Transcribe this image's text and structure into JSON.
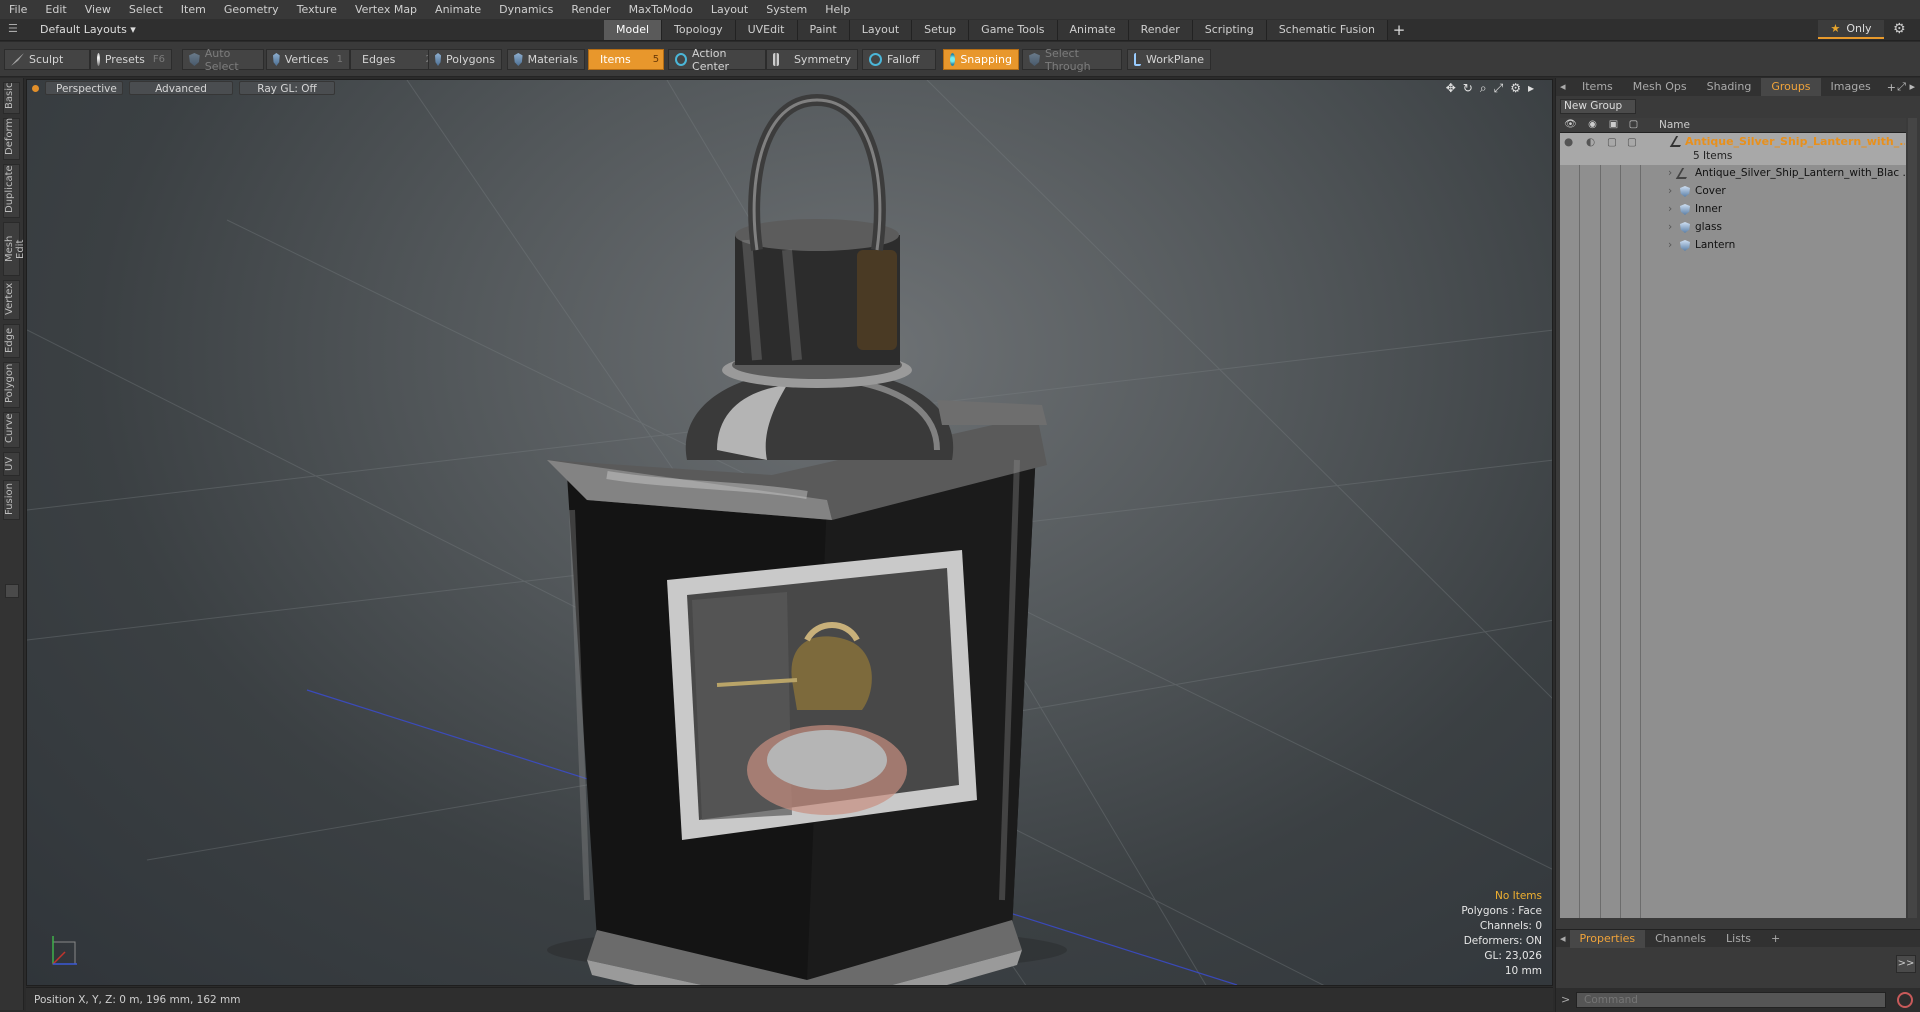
{
  "menu": [
    "File",
    "Edit",
    "View",
    "Select",
    "Item",
    "Geometry",
    "Texture",
    "Vertex Map",
    "Animate",
    "Dynamics",
    "Render",
    "MaxToModo",
    "Layout",
    "System",
    "Help"
  ],
  "layout": {
    "selector": "Default Layouts ▾",
    "only_label": "Only"
  },
  "mode_tabs": [
    {
      "label": "Model",
      "active": true
    },
    {
      "label": "Topology"
    },
    {
      "label": "UVEdit"
    },
    {
      "label": "Paint"
    },
    {
      "label": "Layout"
    },
    {
      "label": "Setup"
    },
    {
      "label": "Game Tools"
    },
    {
      "label": "Animate"
    },
    {
      "label": "Render"
    },
    {
      "label": "Scripting"
    },
    {
      "label": "Schematic Fusion"
    }
  ],
  "toolbar": {
    "sculpt": "Sculpt",
    "presets": "Presets",
    "presets_key": "F6",
    "auto_select": "Auto Select",
    "vertices": "Vertices",
    "vertices_key": "1",
    "edges": "Edges",
    "edges_key": "2",
    "polygons": "Polygons",
    "materials": "Materials",
    "items": "Items",
    "items_key": "5",
    "action_center": "Action Center",
    "symmetry": "Symmetry",
    "falloff": "Falloff",
    "snapping": "Snapping",
    "select_through": "Select Through",
    "workplane": "WorkPlane"
  },
  "left_tabs": [
    "Basic",
    "Deform",
    "Duplicate",
    "Mesh Edit",
    "Vertex",
    "Edge",
    "Polygon",
    "Curve",
    "UV",
    "Fusion"
  ],
  "viewport": {
    "view": "Perspective",
    "shading": "Advanced",
    "raygl": "Ray GL: Off",
    "info": {
      "items": "No Items",
      "polygons": "Polygons : Face",
      "channels": "Channels: 0",
      "deformers": "Deformers: ON",
      "gl": "GL: 23,026",
      "unit": "10 mm"
    }
  },
  "status": {
    "position": "Position X, Y, Z:   0 m, 196 mm, 162 mm"
  },
  "right_panel": {
    "tabs": [
      {
        "label": "Items"
      },
      {
        "label": "Mesh Ops"
      },
      {
        "label": "Shading"
      },
      {
        "label": "Groups",
        "active": true
      },
      {
        "label": "Images"
      }
    ],
    "new_group": "New Group",
    "name_header": "Name",
    "group": {
      "name": "Antique_Silver_Ship_Lantern_with_...",
      "count": "5 Items"
    },
    "children": [
      {
        "label": "Antique_Silver_Ship_Lantern_with_Blac ...",
        "icon": "locator-icon"
      },
      {
        "label": "Cover",
        "icon": "mesh-icon"
      },
      {
        "label": "Inner",
        "icon": "mesh-icon"
      },
      {
        "label": "glass",
        "icon": "mesh-icon"
      },
      {
        "label": "Lantern",
        "icon": "mesh-icon"
      }
    ],
    "bottom_tabs": [
      {
        "label": "Properties",
        "active": true
      },
      {
        "label": "Channels"
      },
      {
        "label": "Lists"
      }
    ],
    "expand": ">>",
    "command_placeholder": "Command"
  },
  "colors": {
    "accent": "#e8972c",
    "group_name": "#e8901c",
    "viewport_bg": "#4a4f52"
  }
}
